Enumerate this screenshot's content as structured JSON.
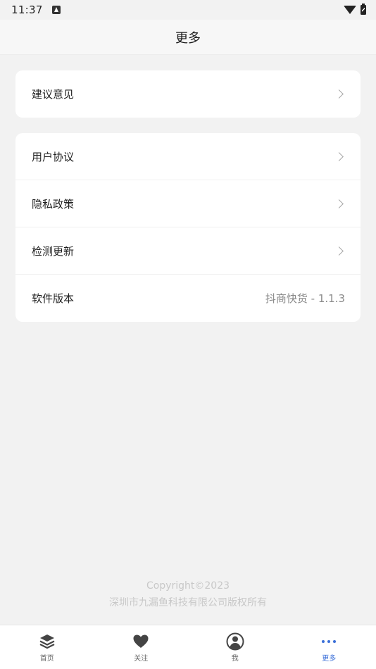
{
  "status_bar": {
    "time": "11:37"
  },
  "header": {
    "title": "更多"
  },
  "group1": [
    {
      "label": "建议意见"
    }
  ],
  "group2": [
    {
      "label": "用户协议"
    },
    {
      "label": "隐私政策"
    },
    {
      "label": "检测更新"
    },
    {
      "label": "软件版本",
      "value": "抖商快货 - 1.1.3"
    }
  ],
  "footer": {
    "copyright": "Copyright©2023",
    "company": "深圳市九漏鱼科技有限公司版权所有"
  },
  "tabbar": {
    "active": "更多",
    "tabs": [
      {
        "label": "首页",
        "icon": "layers-icon"
      },
      {
        "label": "关注",
        "icon": "heart-icon"
      },
      {
        "label": "我",
        "icon": "user-icon"
      },
      {
        "label": "更多",
        "icon": "more-dots-icon"
      }
    ]
  },
  "colors": {
    "accent": "#3b6fd8",
    "background": "#f2f2f2"
  }
}
